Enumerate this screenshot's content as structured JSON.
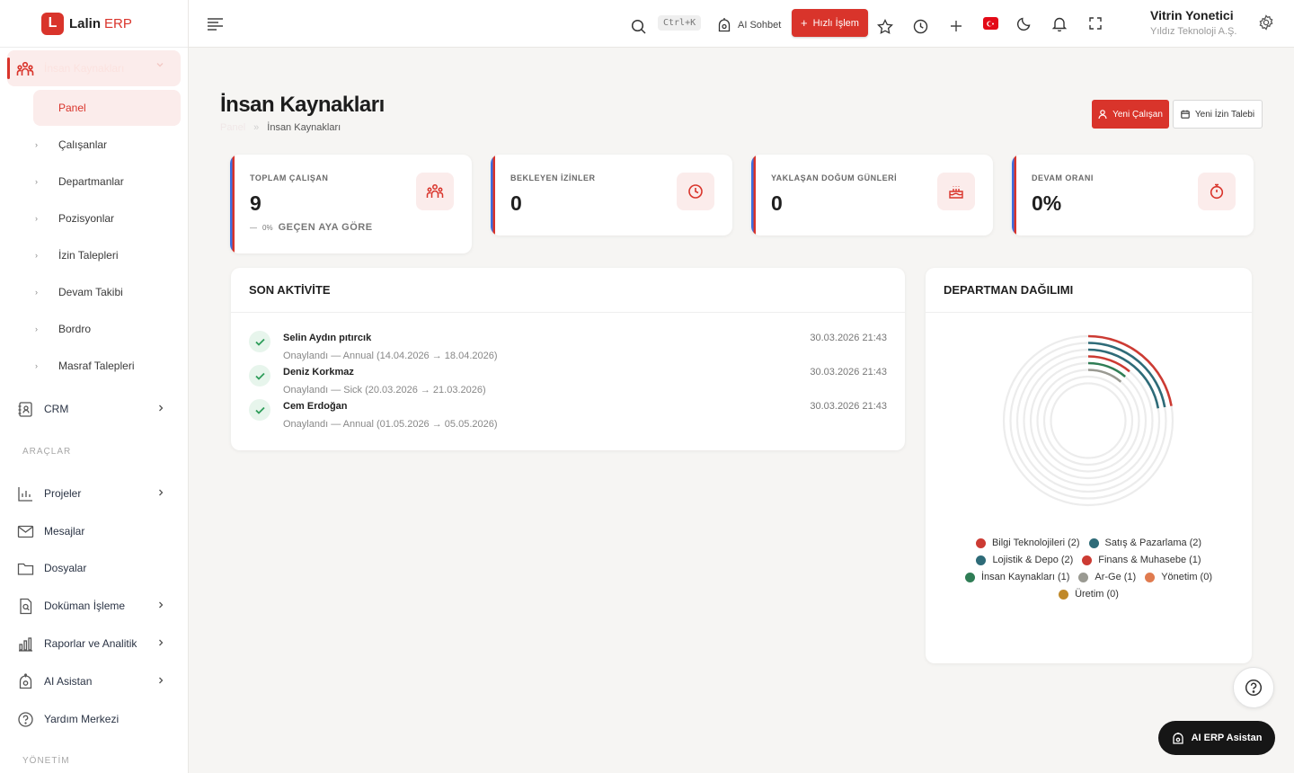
{
  "brand": {
    "name": "Lalin",
    "suffix": "ERP",
    "logo_letter": "L"
  },
  "sidebar": {
    "active_parent": {
      "label": "İnsan Kaynakları",
      "icon": "people-icon"
    },
    "sub_items": [
      {
        "label": "Panel",
        "active": true
      },
      {
        "label": "Çalışanlar"
      },
      {
        "label": "Departmanlar"
      },
      {
        "label": "Pozisyonlar"
      },
      {
        "label": "İzin Talepleri"
      },
      {
        "label": "Devam Takibi"
      },
      {
        "label": "Bordro"
      },
      {
        "label": "Masraf Talepleri"
      }
    ],
    "crm": {
      "label": "CRM",
      "icon": "contacts-icon"
    },
    "section_tools": "ARAÇLAR",
    "tools": [
      {
        "label": "Projeler",
        "icon": "projects-icon",
        "chevron": true
      },
      {
        "label": "Mesajlar",
        "icon": "mail-icon",
        "chevron": false
      },
      {
        "label": "Dosyalar",
        "icon": "folder-icon",
        "chevron": false
      },
      {
        "label": "Doküman İşleme",
        "icon": "document-search-icon",
        "chevron": true
      },
      {
        "label": "Raporlar ve Analitik",
        "icon": "bar-chart-icon",
        "chevron": true
      },
      {
        "label": "AI Asistan",
        "icon": "robot-icon",
        "chevron": true
      },
      {
        "label": "Yardım Merkezi",
        "icon": "help-icon",
        "chevron": false
      }
    ],
    "section_admin": "YÖNETİM"
  },
  "topbar": {
    "shortcut": "Ctrl+K",
    "ai_chat": "AI Sohbet",
    "quick_action": "Hızlı İşlem",
    "user_name": "Vitrin Yonetici",
    "user_org": "Yıldız Teknoloji A.Ş."
  },
  "page": {
    "title": "İnsan Kaynakları",
    "breadcrumb_root": "Panel",
    "breadcrumb_current": "İnsan Kaynakları",
    "btn_new_employee": "Yeni Çalışan",
    "btn_new_leave": "Yeni İzin Talebi"
  },
  "kpis": [
    {
      "label": "TOPLAM ÇALIŞAN",
      "value": "9",
      "trend_pct": "0%",
      "trend_text": "GEÇEN AYA GÖRE",
      "icon": "people-icon"
    },
    {
      "label": "BEKLEYEN İZİNLER",
      "value": "0",
      "icon": "clock-icon"
    },
    {
      "label": "YAKLAŞAN DOĞUM GÜNLERİ",
      "value": "0",
      "icon": "cake-icon"
    },
    {
      "label": "DEVAM ORANI",
      "value": "0%",
      "icon": "stopwatch-icon"
    }
  ],
  "activity": {
    "title": "SON AKTİVİTE",
    "items": [
      {
        "name": "Selin Aydın pıtırcık",
        "desc": "Onaylandı — Annual (14.04.2026 → 18.04.2026)",
        "time": "30.03.2026 21:43"
      },
      {
        "name": "Deniz Korkmaz",
        "desc": "Onaylandı — Sick (20.03.2026 → 21.03.2026)",
        "time": "30.03.2026 21:43"
      },
      {
        "name": "Cem Erdoğan",
        "desc": "Onaylandı — Annual (01.05.2026 → 05.05.2026)",
        "time": "30.03.2026 21:43"
      }
    ]
  },
  "departments": {
    "title": "DEPARTMAN DAĞILIMI"
  },
  "chart_data": {
    "type": "radial-bar",
    "title": "DEPARTMAN DAĞILIMI",
    "max": 9,
    "series": [
      {
        "name": "Bilgi Teknolojileri",
        "value": 2,
        "color": "#cc3b33"
      },
      {
        "name": "Satış & Pazarlama",
        "value": 2,
        "color": "#2e6b78"
      },
      {
        "name": "Lojistik & Depo",
        "value": 2,
        "color": "#2e6b78"
      },
      {
        "name": "Finans & Muhasebe",
        "value": 1,
        "color": "#cc3b33"
      },
      {
        "name": "İnsan Kaynakları",
        "value": 1,
        "color": "#2f7d55"
      },
      {
        "name": "Ar-Ge",
        "value": 1,
        "color": "#9a9a92"
      },
      {
        "name": "Yönetim",
        "value": 0,
        "color": "#e07b4f"
      },
      {
        "name": "Üretim",
        "value": 0,
        "color": "#c0892a"
      }
    ]
  },
  "floating": {
    "ai_assistant": "AI ERP Asistan"
  },
  "colors": {
    "accent": "#d9342b",
    "success": "#2f9e5b"
  }
}
